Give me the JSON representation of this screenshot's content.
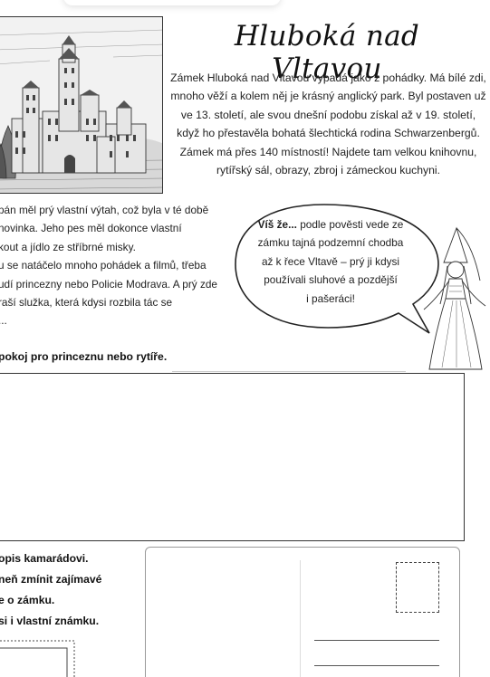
{
  "title": "Hluboká nad Vltavou",
  "intro_lines": [
    "Zámek Hluboká nad Vltavou vypadá jako z pohádky. Má bílé zdi,",
    "mnoho věží a kolem něj je krásný anglický park. Byl postaven už",
    "ve 13. století, ale svou dnešní podobu získal až v 19. století,",
    "když ho přestavěla bohatá šlechtická rodina Schwarzenbergů.",
    "Zámek má přes 140 místností! Najdete tam velkou knihovnu,",
    "rytířský sál, obrazy, zbroj i zámeckou kuchyni."
  ],
  "left_lines": [
    " pán měl prý vlastní výtah, což byla v té době",
    " novinka. Jeho pes měl dokonce vlastní",
    " kout a jídlo ze stříbrné misky.",
    "u se natáčelo mnoho pohádek a filmů, třeba",
    "udí princezny nebo Policie Modrava. A prý zde",
    "raší služka, která kdysi rozbila tác se",
    "..."
  ],
  "bubble": {
    "lead": "Víš že...",
    "line1_rest": " podle pověsti vede ze",
    "lines": [
      "zámku tajná podzemní chodba",
      "až k řece Vltavě – prý ji kdysi",
      "používali sluhové a pozdější",
      "i pašeráci!"
    ]
  },
  "task1": "pokoj pro princeznu nebo rytíře.",
  "task2_lines": [
    "opis kamarádovi.",
    "neň zmínit zajímavé",
    "e o zámku.",
    "si i vlastní známku."
  ],
  "icons": {
    "castle": "castle-engraving-icon",
    "princess": "princess-drawing-icon",
    "stamp": "postage-stamp-icon"
  }
}
